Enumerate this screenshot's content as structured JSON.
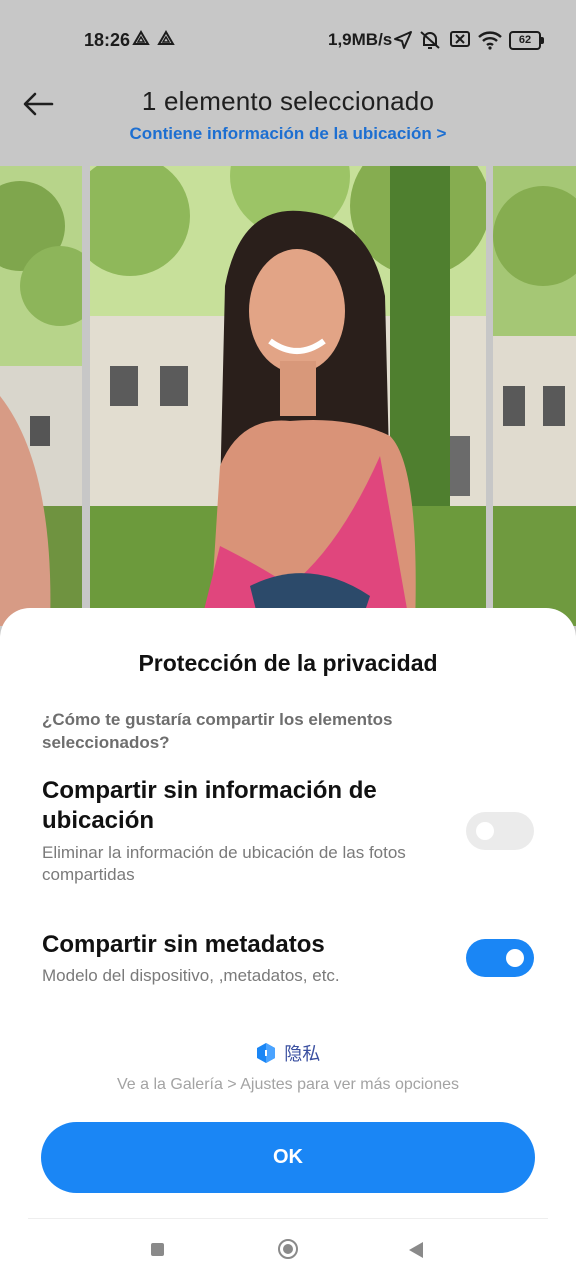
{
  "status_bar": {
    "time": "18:26",
    "speed": "1,9MB/s",
    "battery": "62",
    "icons": [
      "drive-icon",
      "drive-icon",
      "location-arrow-icon",
      "muted-bell-icon",
      "sim-off-icon",
      "wifi-icon",
      "battery-icon"
    ]
  },
  "header": {
    "title": "1 elemento seleccionado",
    "location_link": "Contiene información de la ubicación >"
  },
  "sheet": {
    "title": "Protección de la privacidad",
    "question": "¿Cómo te gustaría compartir los elementos seleccionados?",
    "options": [
      {
        "title": "Compartir sin información de ubicación",
        "description": "Eliminar la información de ubicación de las fotos compartidas",
        "enabled": false
      },
      {
        "title": "Compartir sin metadatos",
        "description": "Modelo del dispositivo, ,metadatos, etc.",
        "enabled": true
      }
    ],
    "brand_text": "隐私",
    "hint": "Ve a la Galería > Ajustes para ver más opciones",
    "ok_label": "OK"
  },
  "colors": {
    "accent": "#1a86f5",
    "link": "#1d6fd1",
    "toggle_off": "#ebebeb"
  },
  "nav": {
    "icons": [
      "recent-apps-icon",
      "home-icon",
      "back-icon"
    ]
  }
}
